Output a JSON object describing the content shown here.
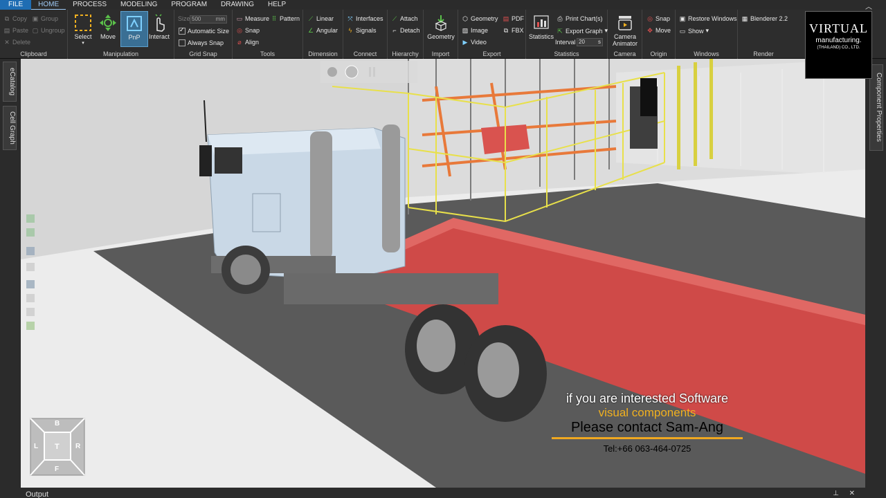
{
  "menu": {
    "items": [
      "FILE",
      "HOME",
      "PROCESS",
      "MODELING",
      "PROGRAM",
      "DRAWING",
      "HELP"
    ],
    "active": "HOME"
  },
  "ribbon": {
    "clipboard": {
      "label": "Clipboard",
      "copy": "Copy",
      "paste": "Paste",
      "delete": "Delete",
      "group": "Group",
      "ungroup": "Ungroup"
    },
    "manipulation": {
      "label": "Manipulation",
      "select": "Select",
      "move": "Move",
      "pnp": "PnP",
      "interact": "Interact"
    },
    "grid_snap": {
      "label": "Grid Snap",
      "size_label": "Size",
      "size_value": "500",
      "size_unit": "mm",
      "automatic_size": "Automatic Size",
      "always_snap": "Always Snap"
    },
    "tools": {
      "label": "Tools",
      "measure": "Measure",
      "pattern": "Pattern",
      "snap": "Snap",
      "align": "Align"
    },
    "dimension": {
      "label": "Dimension",
      "linear": "Linear",
      "angular": "Angular"
    },
    "connect": {
      "label": "Connect",
      "interfaces": "Interfaces",
      "signals": "Signals"
    },
    "hierarchy": {
      "label": "Hierarchy",
      "attach": "Attach",
      "detach": "Detach"
    },
    "import": {
      "label": "Import",
      "geometry": "Geometry"
    },
    "export": {
      "label": "Export",
      "geometry": "Geometry",
      "pdf": "PDF",
      "image": "Image",
      "fbx": "FBX",
      "video": "Video"
    },
    "statistics": {
      "label": "Statistics",
      "statistics": "Statistics",
      "print_charts": "Print Chart(s)",
      "export_graph": "Export Graph",
      "interval_label": "Interval",
      "interval_value": "20",
      "interval_unit": "s"
    },
    "camera": {
      "label": "Camera",
      "camera_animator": "Camera Animator"
    },
    "origin": {
      "label": "Origin",
      "snap": "Snap",
      "move": "Move"
    },
    "windows": {
      "label": "Windows",
      "restore": "Restore Windows",
      "show": "Show"
    },
    "render": {
      "label": "Render",
      "blenderer": "Blenderer 2.2"
    }
  },
  "logo": {
    "line1": "VIRTUAL",
    "line2": "manufacturing.",
    "line3": "(THAILAND) CO., LTD."
  },
  "left_tabs": [
    "eCatalog",
    "Cell Graph"
  ],
  "right_tabs": [
    "Component Properties"
  ],
  "nav_cube": {
    "top": "B",
    "left": "L",
    "center": "T",
    "right": "R",
    "bottom": "F"
  },
  "overlay": {
    "line1": "if you are interested Software",
    "line2": "visual components",
    "line3": "Please contact Sam-Ang",
    "line4": "Tel:+66 063-464-0725"
  },
  "output_panel": {
    "title": "Output"
  },
  "colors": {
    "accent": "#1f6db3",
    "flatbed": "#d9534f",
    "fence": "#e8e04a",
    "racks": "#e8793a",
    "truck": "#c9d8e6"
  }
}
